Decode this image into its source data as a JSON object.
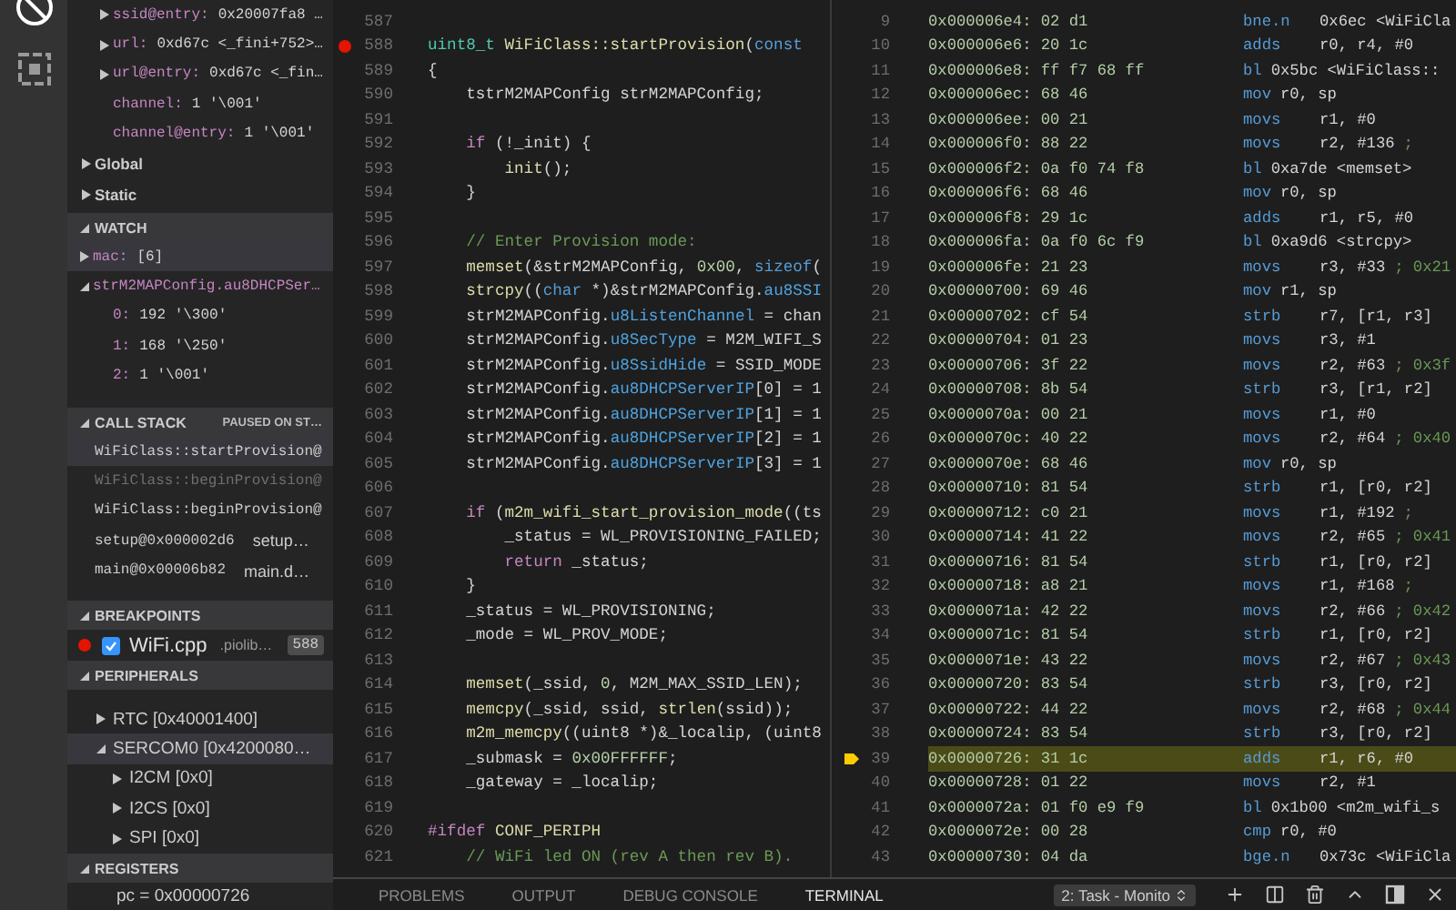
{
  "sidebar": {
    "variables": [
      {
        "name": "ssid@entry:",
        "value": "0x20007fa8 …",
        "expandable": true
      },
      {
        "name": "url:",
        "value": "0xd67c <_fini+752>…",
        "expandable": true
      },
      {
        "name": "url@entry:",
        "value": "0xd67c <_fin…",
        "expandable": true
      },
      {
        "name": "channel:",
        "value": "1 '\\001'",
        "expandable": false
      },
      {
        "name": "channel@entry:",
        "value": "1 '\\001'",
        "expandable": false
      }
    ],
    "scopes": [
      {
        "label": "Global",
        "expanded": false
      },
      {
        "label": "Static",
        "expanded": false
      }
    ],
    "watch": {
      "title": "WATCH",
      "expanded": true,
      "items": [
        {
          "name": "mac:",
          "value": "[6]",
          "expanded": false,
          "selected": true
        },
        {
          "name": "strM2MAPConfig.au8DHCPSer…",
          "expanded": true,
          "selected": false,
          "children": [
            {
              "name": "0:",
              "value": "192 '\\300'"
            },
            {
              "name": "1:",
              "value": "168 '\\250'"
            },
            {
              "name": "2:",
              "value": "1 '\\001'"
            }
          ]
        }
      ]
    },
    "call_stack": {
      "title": "CALL STACK",
      "status": "PAUSED ON ST…",
      "expanded": true,
      "frames": [
        {
          "function": "WiFiClass::startProvision@",
          "selected": true,
          "dimmed": false
        },
        {
          "function": "WiFiClass::beginProvision@",
          "selected": false,
          "dimmed": true
        },
        {
          "function": "WiFiClass::beginProvision@",
          "selected": false,
          "dimmed": false
        },
        {
          "function": "setup@0x000002d6",
          "file": "setup…",
          "selected": false,
          "dimmed": false
        },
        {
          "function": "main@0x00006b82",
          "file": "main.d…",
          "selected": false,
          "dimmed": false
        }
      ]
    },
    "breakpoints": {
      "title": "BREAKPOINTS",
      "expanded": true,
      "items": [
        {
          "file": "WiFi.cpp",
          "path": ".piolib…",
          "line": "588",
          "enabled": true
        }
      ]
    },
    "peripherals": {
      "title": "PERIPHERALS",
      "expanded": true,
      "items": [
        {
          "label": "RTC [0x40001400]",
          "expanded": false,
          "selected": false
        },
        {
          "label": "SERCOM0 [0x4200080…",
          "expanded": true,
          "selected": true,
          "children": [
            {
              "label": "I2CM [0x0]",
              "expanded": false,
              "selected": false
            },
            {
              "label": "I2CS [0x0]",
              "expanded": false,
              "selected": false
            },
            {
              "label": "SPI [0x0]",
              "expanded": false,
              "selected": false
            }
          ]
        }
      ]
    },
    "registers": {
      "title": "REGISTERS",
      "expanded": true,
      "items": [
        {
          "text": "pc = 0x00000726"
        }
      ]
    }
  },
  "source_editor": {
    "lines": [
      {
        "number": "587",
        "breakpoint": false
      },
      {
        "number": "588",
        "breakpoint": true,
        "tokens": [
          {
            "kind": "type2",
            "text": "uint8_t "
          },
          {
            "kind": "fn",
            "text": "WiFiClass::startProvision"
          },
          {
            "kind": "plain",
            "text": "("
          },
          {
            "kind": "type",
            "text": "const"
          }
        ]
      },
      {
        "number": "589",
        "breakpoint": false,
        "tokens": [
          {
            "kind": "plain",
            "text": "{"
          }
        ]
      },
      {
        "number": "590",
        "breakpoint": false,
        "tokens": [
          {
            "kind": "plain",
            "text": "    tstrM2MAPConfig strM2MAPConfig;"
          }
        ]
      },
      {
        "number": "591",
        "breakpoint": false
      },
      {
        "number": "592",
        "breakpoint": false,
        "tokens": [
          {
            "kind": "keyword",
            "text": "    if"
          },
          {
            "kind": "plain",
            "text": " (!_init) {"
          }
        ]
      },
      {
        "number": "593",
        "breakpoint": false,
        "tokens": [
          {
            "kind": "fn",
            "text": "        init"
          },
          {
            "kind": "plain",
            "text": "();"
          }
        ]
      },
      {
        "number": "594",
        "breakpoint": false,
        "tokens": [
          {
            "kind": "plain",
            "text": "    }"
          }
        ]
      },
      {
        "number": "595",
        "breakpoint": false
      },
      {
        "number": "596",
        "breakpoint": false,
        "tokens": [
          {
            "kind": "comment",
            "text": "    // Enter Provision mode:"
          }
        ]
      },
      {
        "number": "597",
        "breakpoint": false,
        "tokens": [
          {
            "kind": "fn",
            "text": "    memset"
          },
          {
            "kind": "plain",
            "text": "(&strM2MAPConfig, "
          },
          {
            "kind": "number",
            "text": "0x00"
          },
          {
            "kind": "plain",
            "text": ", "
          },
          {
            "kind": "type",
            "text": "sizeof"
          },
          {
            "kind": "plain",
            "text": "("
          }
        ]
      },
      {
        "number": "598",
        "breakpoint": false,
        "tokens": [
          {
            "kind": "fn",
            "text": "    strcpy"
          },
          {
            "kind": "plain",
            "text": "(("
          },
          {
            "kind": "type",
            "text": "char"
          },
          {
            "kind": "plain",
            "text": " *)&strM2MAPConfig."
          },
          {
            "kind": "member",
            "text": "au8SSI"
          }
        ]
      },
      {
        "number": "599",
        "breakpoint": false,
        "tokens": [
          {
            "kind": "plain",
            "text": "    strM2MAPConfig."
          },
          {
            "kind": "member",
            "text": "u8ListenChannel"
          },
          {
            "kind": "plain",
            "text": " = chan"
          }
        ]
      },
      {
        "number": "600",
        "breakpoint": false,
        "tokens": [
          {
            "kind": "plain",
            "text": "    strM2MAPConfig."
          },
          {
            "kind": "member",
            "text": "u8SecType"
          },
          {
            "kind": "plain",
            "text": " = M2M_WIFI_S"
          }
        ]
      },
      {
        "number": "601",
        "breakpoint": false,
        "tokens": [
          {
            "kind": "plain",
            "text": "    strM2MAPConfig."
          },
          {
            "kind": "member",
            "text": "u8SsidHide"
          },
          {
            "kind": "plain",
            "text": " = SSID_MODE"
          }
        ]
      },
      {
        "number": "602",
        "breakpoint": false,
        "tokens": [
          {
            "kind": "plain",
            "text": "    strM2MAPConfig."
          },
          {
            "kind": "member",
            "text": "au8DHCPServerIP"
          },
          {
            "kind": "plain",
            "text": "[0] = 1"
          }
        ]
      },
      {
        "number": "603",
        "breakpoint": false,
        "tokens": [
          {
            "kind": "plain",
            "text": "    strM2MAPConfig."
          },
          {
            "kind": "member",
            "text": "au8DHCPServerIP"
          },
          {
            "kind": "plain",
            "text": "[1] = 1"
          }
        ]
      },
      {
        "number": "604",
        "breakpoint": false,
        "tokens": [
          {
            "kind": "plain",
            "text": "    strM2MAPConfig."
          },
          {
            "kind": "member",
            "text": "au8DHCPServerIP"
          },
          {
            "kind": "plain",
            "text": "[2] = 1"
          }
        ]
      },
      {
        "number": "605",
        "breakpoint": false,
        "tokens": [
          {
            "kind": "plain",
            "text": "    strM2MAPConfig."
          },
          {
            "kind": "member",
            "text": "au8DHCPServerIP"
          },
          {
            "kind": "plain",
            "text": "[3] = 1"
          }
        ]
      },
      {
        "number": "606",
        "breakpoint": false
      },
      {
        "number": "607",
        "breakpoint": false,
        "tokens": [
          {
            "kind": "keyword",
            "text": "    if"
          },
          {
            "kind": "plain",
            "text": " ("
          },
          {
            "kind": "fn",
            "text": "m2m_wifi_start_provision_mode"
          },
          {
            "kind": "plain",
            "text": "((ts"
          }
        ]
      },
      {
        "number": "608",
        "breakpoint": false,
        "tokens": [
          {
            "kind": "plain",
            "text": "        _status = WL_PROVISIONING_FAILED;"
          }
        ]
      },
      {
        "number": "609",
        "breakpoint": false,
        "tokens": [
          {
            "kind": "keyword",
            "text": "        return"
          },
          {
            "kind": "plain",
            "text": " _status;"
          }
        ]
      },
      {
        "number": "610",
        "breakpoint": false,
        "tokens": [
          {
            "kind": "plain",
            "text": "    }"
          }
        ]
      },
      {
        "number": "611",
        "breakpoint": false,
        "tokens": [
          {
            "kind": "plain",
            "text": "    _status = WL_PROVISIONING;"
          }
        ]
      },
      {
        "number": "612",
        "breakpoint": false,
        "tokens": [
          {
            "kind": "plain",
            "text": "    _mode = WL_PROV_MODE;"
          }
        ]
      },
      {
        "number": "613",
        "breakpoint": false
      },
      {
        "number": "614",
        "breakpoint": false,
        "tokens": [
          {
            "kind": "fn",
            "text": "    memset"
          },
          {
            "kind": "plain",
            "text": "(_ssid, "
          },
          {
            "kind": "number",
            "text": "0"
          },
          {
            "kind": "plain",
            "text": ", M2M_MAX_SSID_LEN);"
          }
        ]
      },
      {
        "number": "615",
        "breakpoint": false,
        "tokens": [
          {
            "kind": "fn",
            "text": "    memcpy"
          },
          {
            "kind": "plain",
            "text": "(_ssid, ssid, "
          },
          {
            "kind": "fn",
            "text": "strlen"
          },
          {
            "kind": "plain",
            "text": "(ssid));"
          }
        ]
      },
      {
        "number": "616",
        "breakpoint": false,
        "tokens": [
          {
            "kind": "fn",
            "text": "    m2m_memcpy"
          },
          {
            "kind": "plain",
            "text": "((uint8 *)&_localip, (uint8"
          }
        ]
      },
      {
        "number": "617",
        "breakpoint": false,
        "tokens": [
          {
            "kind": "plain",
            "text": "    _submask = "
          },
          {
            "kind": "number",
            "text": "0x00FFFFFF"
          },
          {
            "kind": "plain",
            "text": ";"
          }
        ]
      },
      {
        "number": "618",
        "breakpoint": false,
        "tokens": [
          {
            "kind": "plain",
            "text": "    _gateway = _localip;"
          }
        ]
      },
      {
        "number": "619",
        "breakpoint": false
      },
      {
        "number": "620",
        "breakpoint": false,
        "tokens": [
          {
            "kind": "keyword",
            "text": "#ifdef "
          },
          {
            "kind": "fn",
            "text": "CONF_PERIPH"
          }
        ]
      },
      {
        "number": "621",
        "breakpoint": false,
        "tokens": [
          {
            "kind": "comment",
            "text": "    // WiFi led ON (rev A then rev B)."
          }
        ]
      }
    ]
  },
  "disassembly": {
    "lines": [
      {
        "number": "9",
        "code": "0x000006e4: 02 d1",
        "op": "bne.n",
        "aligned": true,
        "operands": "0x6ec <WiFiCla",
        "current": false
      },
      {
        "number": "10",
        "code": "0x000006e6: 20 1c",
        "op": "adds",
        "aligned": true,
        "operands": "r0, r4, #0",
        "current": false
      },
      {
        "number": "11",
        "code": "0x000006e8: ff f7 68 ff",
        "op": "bl",
        "aligned": false,
        "operands": "0x5bc <WiFiClass::",
        "current": false
      },
      {
        "number": "12",
        "code": "0x000006ec: 68 46",
        "op": "mov",
        "aligned": false,
        "operands": "r0, sp",
        "current": false
      },
      {
        "number": "13",
        "code": "0x000006ee: 00 21",
        "op": "movs",
        "aligned": true,
        "operands": "r1, #0",
        "current": false
      },
      {
        "number": "14",
        "code": "0x000006f0: 88 22",
        "op": "movs",
        "aligned": true,
        "operands": "r2, #136",
        "comment": ";",
        "current": false
      },
      {
        "number": "15",
        "code": "0x000006f2: 0a f0 74 f8",
        "op": "bl",
        "aligned": false,
        "operands": "0xa7de <memset>",
        "current": false
      },
      {
        "number": "16",
        "code": "0x000006f6: 68 46",
        "op": "mov",
        "aligned": false,
        "operands": "r0, sp",
        "current": false
      },
      {
        "number": "17",
        "code": "0x000006f8: 29 1c",
        "op": "adds",
        "aligned": true,
        "operands": "r1, r5, #0",
        "current": false
      },
      {
        "number": "18",
        "code": "0x000006fa: 0a f0 6c f9",
        "op": "bl",
        "aligned": false,
        "operands": "0xa9d6 <strcpy>",
        "current": false
      },
      {
        "number": "19",
        "code": "0x000006fe: 21 23",
        "op": "movs",
        "aligned": true,
        "operands": "r3, #33",
        "comment": "; 0x21",
        "current": false
      },
      {
        "number": "20",
        "code": "0x00000700: 69 46",
        "op": "mov",
        "aligned": false,
        "operands": "r1, sp",
        "current": false
      },
      {
        "number": "21",
        "code": "0x00000702: cf 54",
        "op": "strb",
        "aligned": true,
        "operands": "r7, [r1, r3]",
        "current": false
      },
      {
        "number": "22",
        "code": "0x00000704: 01 23",
        "op": "movs",
        "aligned": true,
        "operands": "r3, #1",
        "current": false
      },
      {
        "number": "23",
        "code": "0x00000706: 3f 22",
        "op": "movs",
        "aligned": true,
        "operands": "r2, #63",
        "comment": "; 0x3f",
        "current": false
      },
      {
        "number": "24",
        "code": "0x00000708: 8b 54",
        "op": "strb",
        "aligned": true,
        "operands": "r3, [r1, r2]",
        "current": false
      },
      {
        "number": "25",
        "code": "0x0000070a: 00 21",
        "op": "movs",
        "aligned": true,
        "operands": "r1, #0",
        "current": false
      },
      {
        "number": "26",
        "code": "0x0000070c: 40 22",
        "op": "movs",
        "aligned": true,
        "operands": "r2, #64",
        "comment": "; 0x40",
        "current": false
      },
      {
        "number": "27",
        "code": "0x0000070e: 68 46",
        "op": "mov",
        "aligned": false,
        "operands": "r0, sp",
        "current": false
      },
      {
        "number": "28",
        "code": "0x00000710: 81 54",
        "op": "strb",
        "aligned": true,
        "operands": "r1, [r0, r2]",
        "current": false
      },
      {
        "number": "29",
        "code": "0x00000712: c0 21",
        "op": "movs",
        "aligned": true,
        "operands": "r1, #192",
        "comment": ";",
        "current": false
      },
      {
        "number": "30",
        "code": "0x00000714: 41 22",
        "op": "movs",
        "aligned": true,
        "operands": "r2, #65",
        "comment": "; 0x41",
        "current": false
      },
      {
        "number": "31",
        "code": "0x00000716: 81 54",
        "op": "strb",
        "aligned": true,
        "operands": "r1, [r0, r2]",
        "current": false
      },
      {
        "number": "32",
        "code": "0x00000718: a8 21",
        "op": "movs",
        "aligned": true,
        "operands": "r1, #168",
        "comment": ";",
        "current": false
      },
      {
        "number": "33",
        "code": "0x0000071a: 42 22",
        "op": "movs",
        "aligned": true,
        "operands": "r2, #66",
        "comment": "; 0x42",
        "current": false
      },
      {
        "number": "34",
        "code": "0x0000071c: 81 54",
        "op": "strb",
        "aligned": true,
        "operands": "r1, [r0, r2]",
        "current": false
      },
      {
        "number": "35",
        "code": "0x0000071e: 43 22",
        "op": "movs",
        "aligned": true,
        "operands": "r2, #67",
        "comment": "; 0x43",
        "current": false
      },
      {
        "number": "36",
        "code": "0x00000720: 83 54",
        "op": "strb",
        "aligned": true,
        "operands": "r3, [r0, r2]",
        "current": false
      },
      {
        "number": "37",
        "code": "0x00000722: 44 22",
        "op": "movs",
        "aligned": true,
        "operands": "r2, #68",
        "comment": "; 0x44",
        "current": false
      },
      {
        "number": "38",
        "code": "0x00000724: 83 54",
        "op": "strb",
        "aligned": true,
        "operands": "r3, [r0, r2]",
        "current": false
      },
      {
        "number": "39",
        "code": "0x00000726: 31 1c",
        "op": "adds",
        "aligned": true,
        "operands": "r1, r6, #0",
        "current": true
      },
      {
        "number": "40",
        "code": "0x00000728: 01 22",
        "op": "movs",
        "aligned": true,
        "operands": "r2, #1",
        "current": false
      },
      {
        "number": "41",
        "code": "0x0000072a: 01 f0 e9 f9",
        "op": "bl",
        "aligned": false,
        "operands": "0x1b00 <m2m_wifi_s",
        "current": false
      },
      {
        "number": "42",
        "code": "0x0000072e: 00 28",
        "op": "cmp",
        "aligned": false,
        "operands": "r0, #0",
        "current": false
      },
      {
        "number": "43",
        "code": "0x00000730: 04 da",
        "op": "bge.n",
        "aligned": true,
        "operands": "0x73c <WiFiCla",
        "current": false
      }
    ]
  },
  "panel": {
    "tabs": [
      {
        "label": "PROBLEMS",
        "selected": false
      },
      {
        "label": "OUTPUT",
        "selected": false
      },
      {
        "label": "DEBUG CONSOLE",
        "selected": false
      },
      {
        "label": "TERMINAL",
        "selected": true
      }
    ],
    "terminal_select": {
      "value": "2: Task - Monito"
    }
  }
}
